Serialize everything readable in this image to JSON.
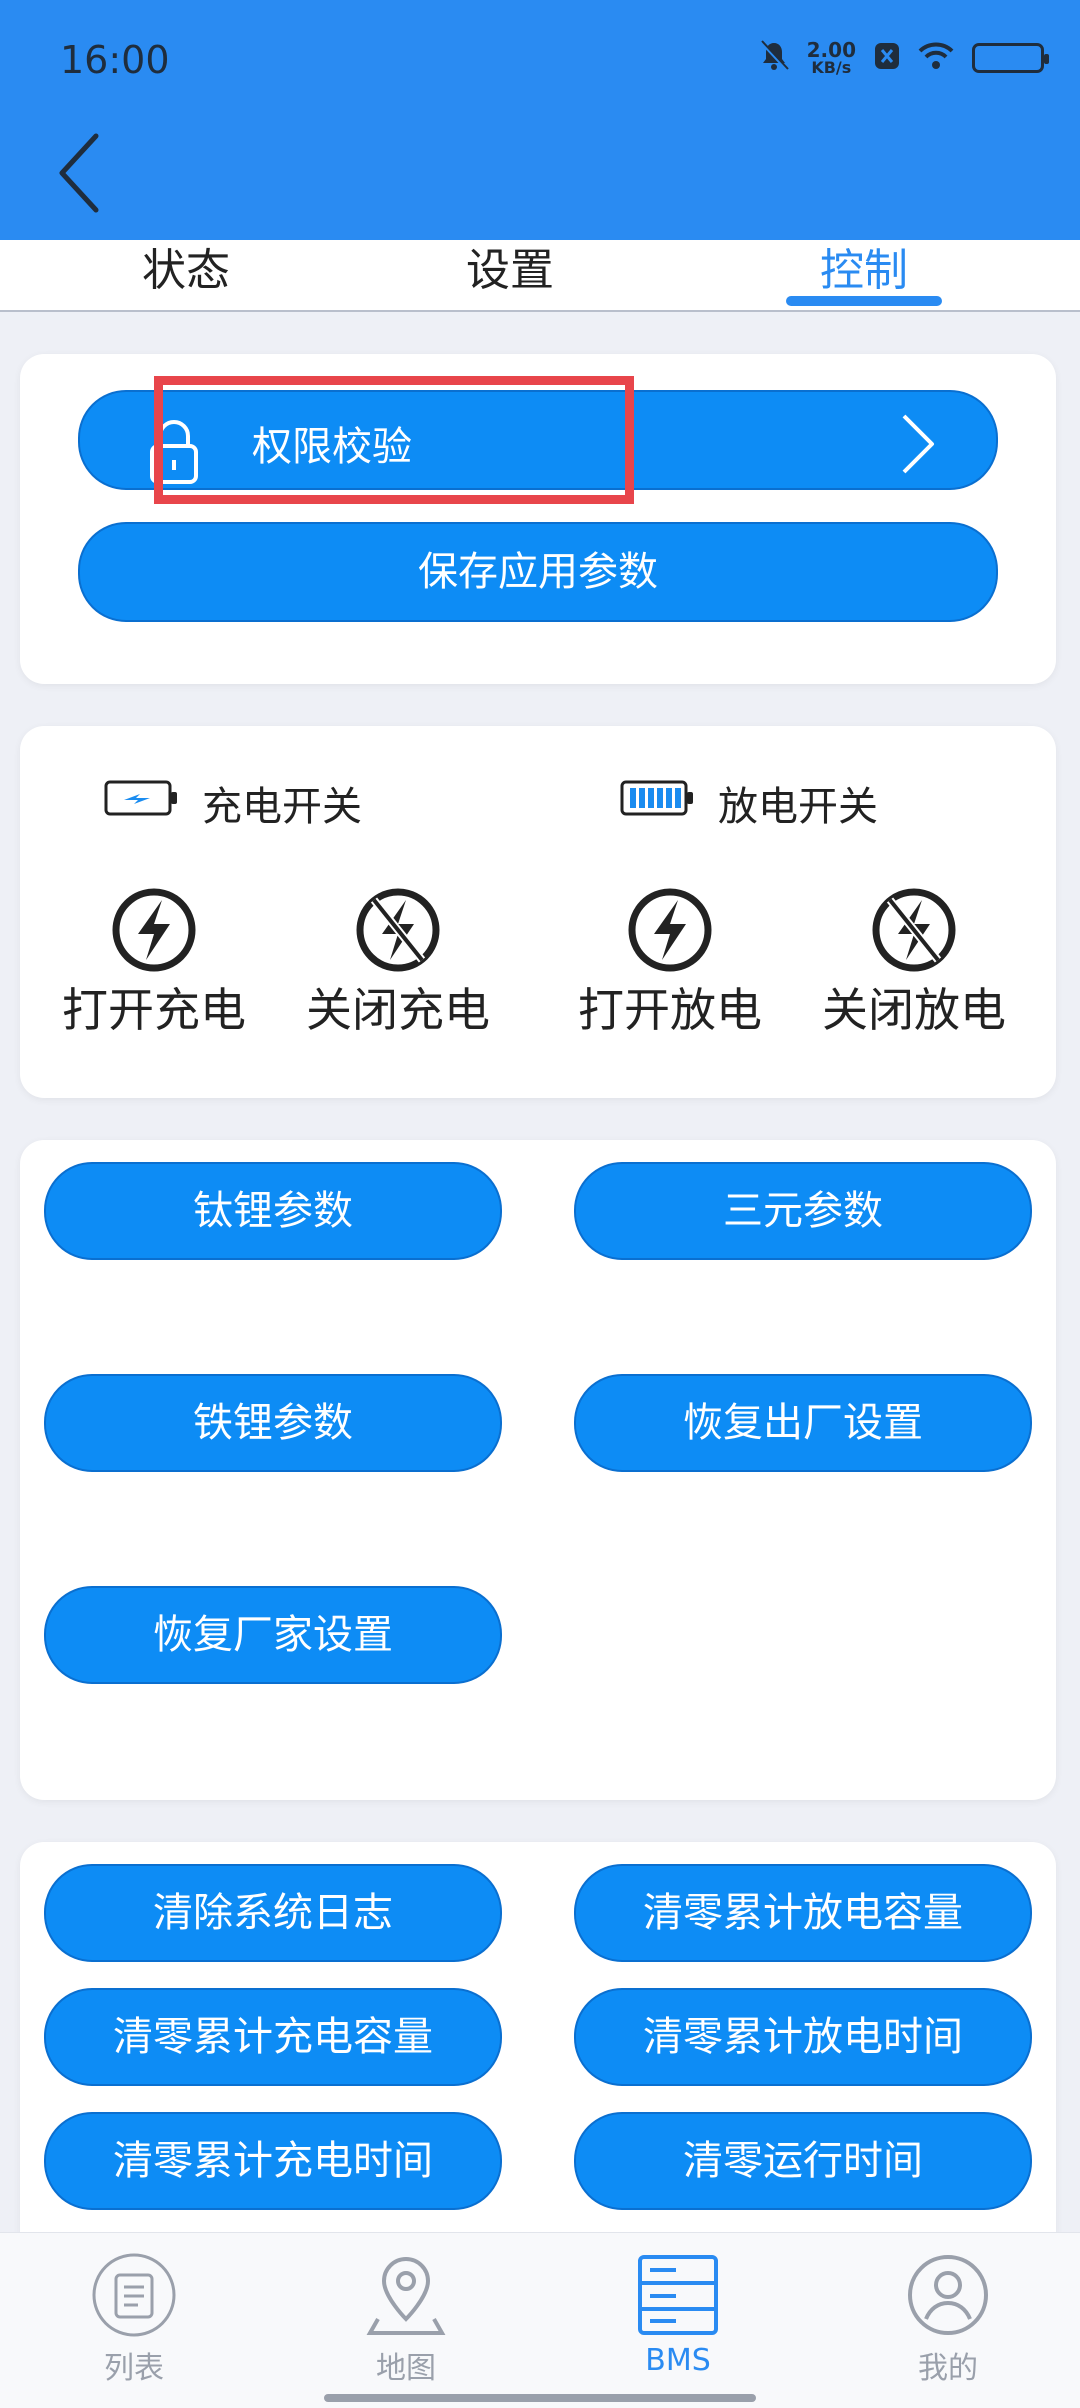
{
  "status_bar": {
    "time": "16:00",
    "speed_value": "2.00",
    "speed_unit": "KB/s"
  },
  "tabs": [
    {
      "label": "状态",
      "active": false
    },
    {
      "label": "设置",
      "active": false
    },
    {
      "label": "控制",
      "active": true
    }
  ],
  "auth_card": {
    "auth_label": "权限校验",
    "save_label": "保存应用参数"
  },
  "switch_card": {
    "charge_switch_label": "充电开关",
    "discharge_switch_label": "放电开关",
    "controls": [
      "打开充电",
      "关闭充电",
      "打开放电",
      "关闭放电"
    ]
  },
  "param_card": {
    "buttons": [
      "钛锂参数",
      "三元参数",
      "铁锂参数",
      "恢复出厂设置",
      "恢复厂家设置"
    ]
  },
  "clear_card": {
    "buttons": [
      "清除系统日志",
      "清零累计放电容量",
      "清零累计充电容量",
      "清零累计放电时间",
      "清零累计充电时间",
      "清零运行时间"
    ]
  },
  "bottom_nav": [
    {
      "label": "列表",
      "icon": "list-icon",
      "active": false
    },
    {
      "label": "地图",
      "icon": "map-pin-icon",
      "active": false
    },
    {
      "label": "BMS",
      "icon": "server-icon",
      "active": true
    },
    {
      "label": "我的",
      "icon": "user-icon",
      "active": false
    }
  ],
  "colors": {
    "accent": "#2a8bf2",
    "button": "#0d8cf5",
    "highlight": "#e8454b"
  }
}
